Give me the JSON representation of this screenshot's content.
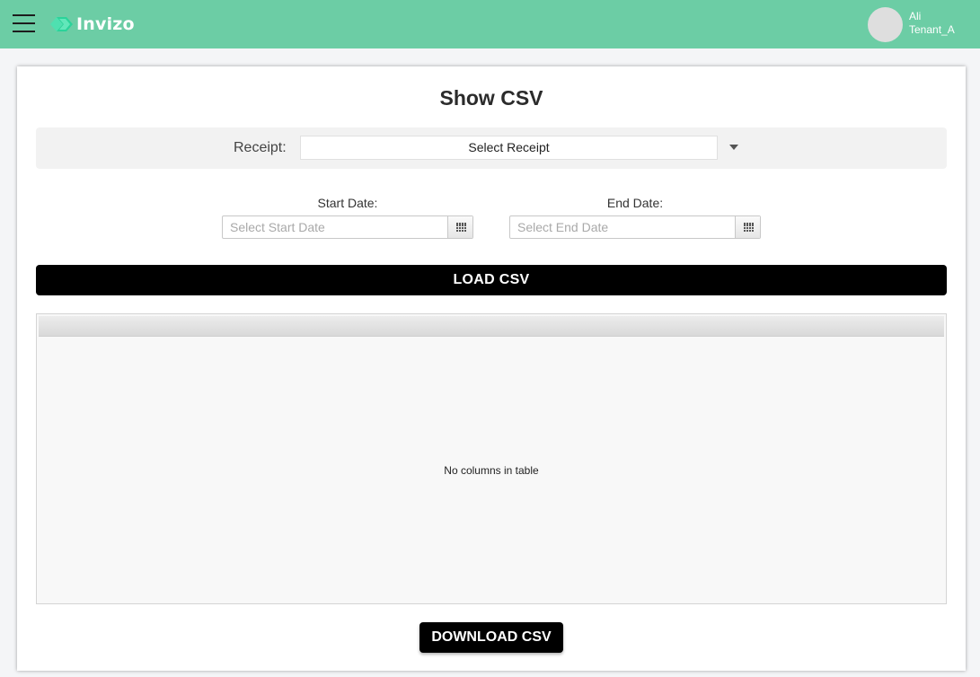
{
  "header": {
    "brand_name": "Invizo",
    "brand_color": "#6ccda5",
    "user": {
      "name": "Ali",
      "tenant": "Tenant_A"
    }
  },
  "page": {
    "title": "Show CSV"
  },
  "receipt": {
    "label": "Receipt:",
    "selected_value": "Select Receipt"
  },
  "dates": {
    "start": {
      "label": "Start Date:",
      "placeholder": "Select Start Date",
      "value": ""
    },
    "end": {
      "label": "End Date:",
      "placeholder": "Select End Date",
      "value": ""
    }
  },
  "actions": {
    "load_label": "LOAD CSV",
    "download_label": "DOWNLOAD CSV"
  },
  "table": {
    "columns": [],
    "rows": [],
    "empty_message": "No columns in table"
  },
  "icons": {
    "menu": "hamburger-menu-icon",
    "logo": "invizo-logo-icon",
    "dropdown": "caret-down-icon",
    "calendar": "calendar-icon"
  }
}
